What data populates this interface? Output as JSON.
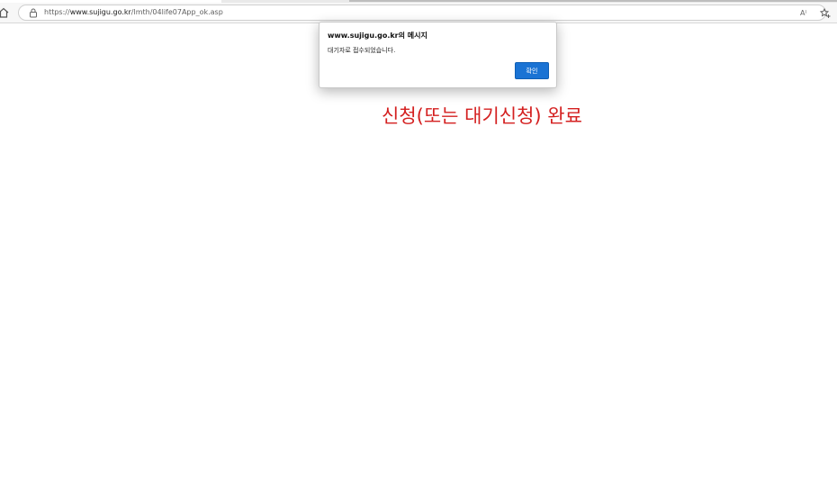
{
  "browser": {
    "url_prefix": "https://",
    "url_domain": "www.sujigu.go.kr",
    "url_path": "/lmth/04life07App_ok.asp",
    "read_aloud_label": "A⁾"
  },
  "dialog": {
    "title": "www.sujigu.go.kr의 메시지",
    "message": "대기자로 접수되었습니다.",
    "ok_label": "확인"
  },
  "annotation": {
    "text": "신청(또는 대기신청) 완료",
    "color": "#d42020"
  },
  "icons": [
    "home-icon",
    "lock-icon",
    "read-aloud-icon",
    "favorites-icon"
  ]
}
